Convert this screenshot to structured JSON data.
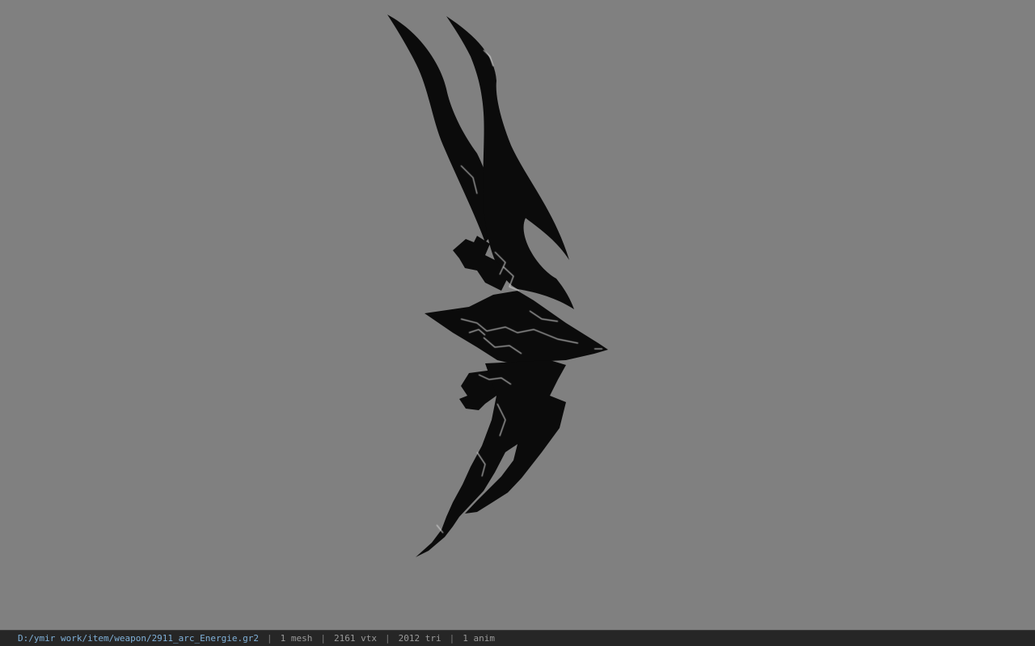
{
  "viewer": {
    "background_color": "#808080",
    "model_color": "#0a0a0a",
    "highlight_color": "#d8d8d8",
    "model_icon": "bow-weapon-model"
  },
  "status": {
    "file_path": "D:/ymir work/item/weapon/2911_arc_Energie.gr2",
    "separator": "|",
    "mesh": "1 mesh",
    "vertices": "2161 vtx",
    "triangles": "2012 tri",
    "animations": "1 anim"
  }
}
